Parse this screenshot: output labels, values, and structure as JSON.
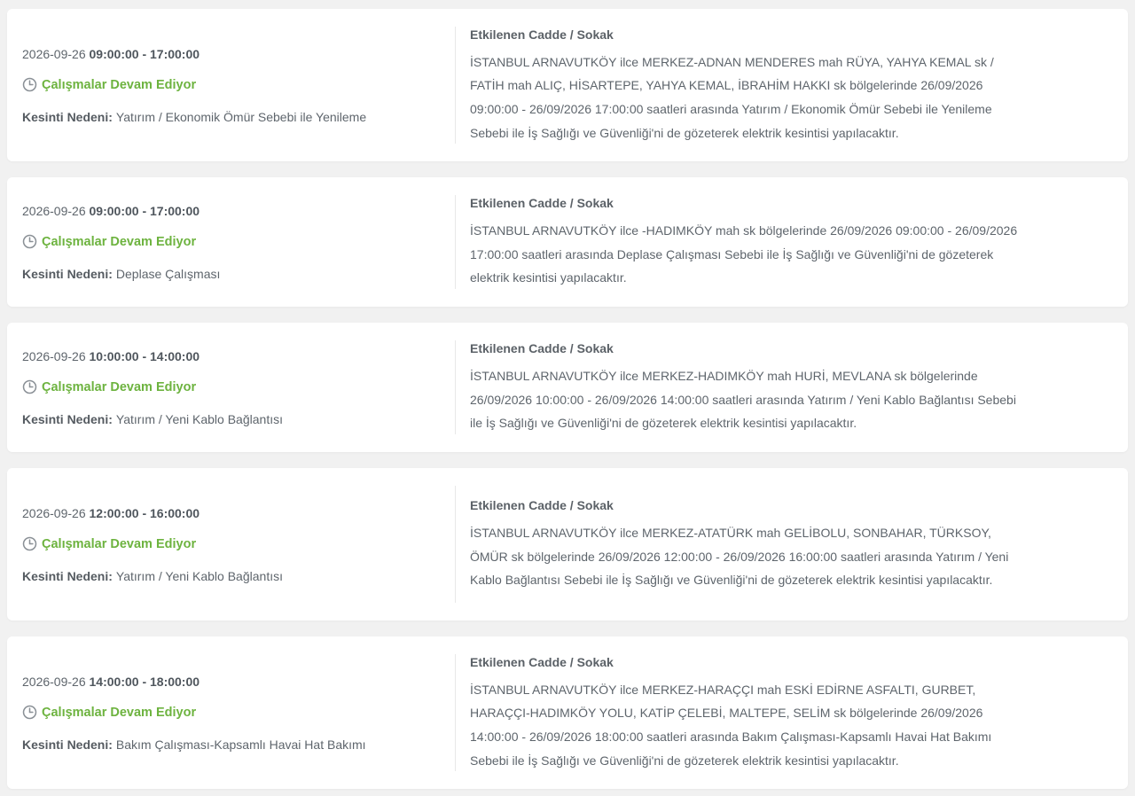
{
  "outages": [
    {
      "date": "2026-09-26",
      "time_range": "09:00:00 - 17:00:00",
      "status": "Çalışmalar Devam Ediyor",
      "reason_label": "Kesinti Nedeni:",
      "reason": "Yatırım / Ekonomik Ömür Sebebi ile Yenileme",
      "heading": "Etkilenen Cadde / Sokak",
      "description": "İSTANBUL ARNAVUTKÖY ilce MERKEZ-ADNAN MENDERES mah RÜYA, YAHYA KEMAL sk / FATİH mah ALIÇ, HİSARTEPE, YAHYA KEMAL, İBRAHİM HAKKI sk bölgelerinde 26/09/2026 09:00:00 - 26/09/2026 17:00:00 saatleri arasında Yatırım / Ekonomik Ömür Sebebi ile Yenileme Sebebi ile İş Sağlığı ve Güvenliği'ni de gözeterek elektrik kesintisi yapılacaktır."
    },
    {
      "date": "2026-09-26",
      "time_range": "09:00:00 - 17:00:00",
      "status": "Çalışmalar Devam Ediyor",
      "reason_label": "Kesinti Nedeni:",
      "reason": "Deplase Çalışması",
      "heading": "Etkilenen Cadde / Sokak",
      "description": "İSTANBUL ARNAVUTKÖY ilce -HADIMKÖY mah sk bölgelerinde 26/09/2026 09:00:00 - 26/09/2026 17:00:00 saatleri arasında Deplase Çalışması Sebebi ile İş Sağlığı ve Güvenliği'ni de gözeterek elektrik kesintisi yapılacaktır."
    },
    {
      "date": "2026-09-26",
      "time_range": "10:00:00 - 14:00:00",
      "status": "Çalışmalar Devam Ediyor",
      "reason_label": "Kesinti Nedeni:",
      "reason": "Yatırım / Yeni Kablo Bağlantısı",
      "heading": "Etkilenen Cadde / Sokak",
      "description": "İSTANBUL ARNAVUTKÖY ilce MERKEZ-HADIMKÖY mah HURİ, MEVLANA sk bölgelerinde 26/09/2026 10:00:00 - 26/09/2026 14:00:00 saatleri arasında Yatırım / Yeni Kablo Bağlantısı Sebebi ile İş Sağlığı ve Güvenliği'ni de gözeterek elektrik kesintisi yapılacaktır."
    },
    {
      "date": "2026-09-26",
      "time_range": "12:00:00 - 16:00:00",
      "status": "Çalışmalar Devam Ediyor",
      "reason_label": "Kesinti Nedeni:",
      "reason": "Yatırım / Yeni Kablo Bağlantısı",
      "heading": "Etkilenen Cadde / Sokak",
      "description": "İSTANBUL ARNAVUTKÖY ilce MERKEZ-ATATÜRK mah GELİBOLU, SONBAHAR, TÜRKSOY, ÖMÜR sk bölgelerinde 26/09/2026 12:00:00 - 26/09/2026 16:00:00 saatleri arasında Yatırım / Yeni Kablo Bağlantısı Sebebi ile İş Sağlığı ve Güvenliği'ni de gözeterek elektrik kesintisi yapılacaktır."
    },
    {
      "date": "2026-09-26",
      "time_range": "14:00:00 - 18:00:00",
      "status": "Çalışmalar Devam Ediyor",
      "reason_label": "Kesinti Nedeni:",
      "reason": "Bakım Çalışması-Kapsamlı Havai Hat Bakımı",
      "heading": "Etkilenen Cadde / Sokak",
      "description": "İSTANBUL ARNAVUTKÖY ilce MERKEZ-HARAÇÇI mah ESKİ EDİRNE ASFALTI, GURBET, HARAÇÇI-HADIMKÖY YOLU, KATİP ÇELEBİ, MALTEPE, SELİM sk bölgelerinde 26/09/2026 14:00:00 - 26/09/2026 18:00:00 saatleri arasında Bakım Çalışması-Kapsamlı Havai Hat Bakımı Sebebi ile İş Sağlığı ve Güvenliği'ni de gözeterek elektrik kesintisi yapılacaktır."
    }
  ],
  "icons": {
    "status": "clock-icon"
  },
  "colors": {
    "status_green": "#6db33f",
    "card_bg": "#ffffff",
    "page_bg": "#f1f1f1"
  }
}
